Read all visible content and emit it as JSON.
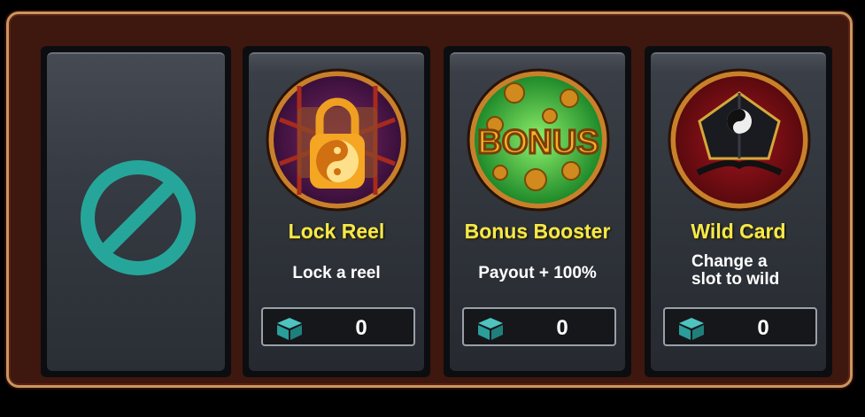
{
  "items": [
    {
      "title": "Lock Reel",
      "description": "Lock a reel",
      "count": "0",
      "icon": "lock-reel-icon"
    },
    {
      "title": "Bonus Booster",
      "description": "Payout + 100%",
      "count": "0",
      "icon": "bonus-icon",
      "icon_text": "BONUS"
    },
    {
      "title": "Wild Card",
      "description_lines": [
        "Change a",
        "slot to wild"
      ],
      "count": "0",
      "icon": "wild-card-icon"
    }
  ],
  "empty_slot": {
    "icon": "no-item-icon"
  },
  "colors": {
    "frame": "#3e170e",
    "frame_border": "#c99660",
    "title": "#f5e84a",
    "accent": "#26a69a"
  }
}
